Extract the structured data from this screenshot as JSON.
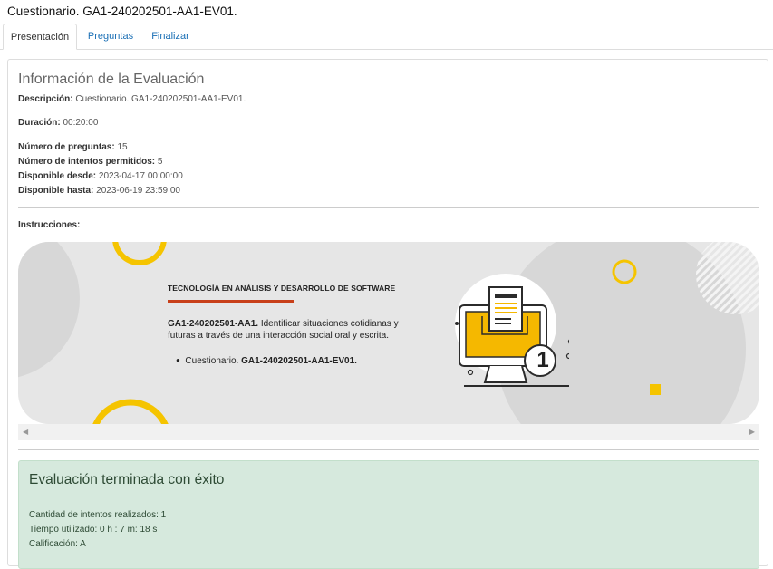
{
  "page_title": "Cuestionario. GA1-240202501-AA1-EV01.",
  "tabs": [
    {
      "label": "Presentación",
      "active": true
    },
    {
      "label": "Preguntas",
      "active": false
    },
    {
      "label": "Finalizar",
      "active": false
    }
  ],
  "info": {
    "title": "Información de la Evaluación",
    "descripcion_label": "Descripción:",
    "descripcion_value": "Cuestionario. GA1-240202501-AA1-EV01.",
    "duracion_label": "Duración:",
    "duracion_value": "00:20:00",
    "num_preguntas_label": "Número de preguntas:",
    "num_preguntas_value": "15",
    "num_intentos_label": "Número de intentos permitidos:",
    "num_intentos_value": "5",
    "desde_label": "Disponible desde:",
    "desde_value": "2023-04-17 00:00:00",
    "hasta_label": "Disponible hasta:",
    "hasta_value": "2023-06-19 23:59:00",
    "instrucciones_label": "Instrucciones:"
  },
  "banner": {
    "heading": "TECNOLOGÍA EN ANÁLISIS Y DESARROLLO DE SOFTWARE",
    "code_bold": "GA1-240202501-AA1.",
    "text_line1": " Identificar situaciones cotidianas y",
    "text_line2": "futuras a través de una interacción social oral y escrita.",
    "bullet_prefix": "Cuestionario.",
    "bullet_bold": " GA1-240202501-AA1-EV01.",
    "badge_number": "1",
    "colors": {
      "accent": "#f5c400",
      "rule": "#c8401a",
      "background": "#e6e6e6"
    }
  },
  "result": {
    "title": "Evaluación terminada con éxito",
    "intentos": "Cantidad de intentos realizados: 1",
    "tiempo": "Tiempo utilizado: 0 h : 7 m: 18 s",
    "calificacion": "Calificación: A"
  }
}
